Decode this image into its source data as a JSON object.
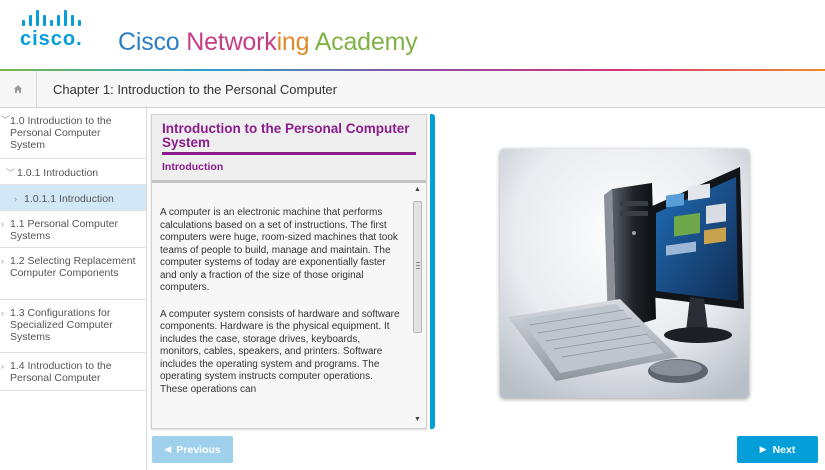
{
  "header": {
    "logo_text": "cisco.",
    "academy_title_parts": [
      "Cisco ",
      "Network",
      "ing ",
      "Academy"
    ],
    "colors": {
      "cisco_blue": "#049fd9",
      "purple": "#8b1c8c"
    }
  },
  "chapter_bar": {
    "home_icon": "home-icon",
    "title": "Chapter 1: Introduction to the Personal Computer"
  },
  "sidebar": {
    "items": [
      {
        "label": "1.0 Introduction to the Personal Computer System",
        "chevron": "﹀",
        "selected": false
      },
      {
        "label": "1.0.1 Introduction",
        "chevron": "﹀",
        "selected": false
      },
      {
        "label": "1.0.1.1 Introduction",
        "chevron": "›",
        "selected": true
      },
      {
        "label": "1.1 Personal Computer Systems",
        "chevron": "›",
        "selected": false
      },
      {
        "label": "1.2 Selecting Replacement Computer Components",
        "chevron": "›",
        "selected": false
      },
      {
        "label": "1.3 Configurations for Specialized Computer Systems",
        "chevron": "›",
        "selected": false
      },
      {
        "label": "1.4 Introduction to the Personal Computer",
        "chevron": "›",
        "selected": false
      }
    ]
  },
  "content": {
    "title": "Introduction to the Personal Computer System",
    "subtitle": "Introduction",
    "paragraphs": [
      "A computer is an electronic machine that performs calculations based on a set of instructions. The first computers were huge, room-sized machines that took teams of people to build, manage and maintain. The computer systems of today are exponentially faster and only a fraction of the size of those original computers.",
      "A computer system consists of hardware and software components. Hardware is the physical equipment. It includes the case, storage drives, keyboards, monitors, cables, speakers, and printers. Software includes the operating system and programs. The operating system instructs computer operations. These operations can"
    ],
    "scroll_up_glyph": "▲",
    "scroll_down_glyph": "▼"
  },
  "footer": {
    "previous_label": "Previous",
    "next_label": "Next",
    "previous_icon": "◀",
    "next_icon": "▶"
  }
}
